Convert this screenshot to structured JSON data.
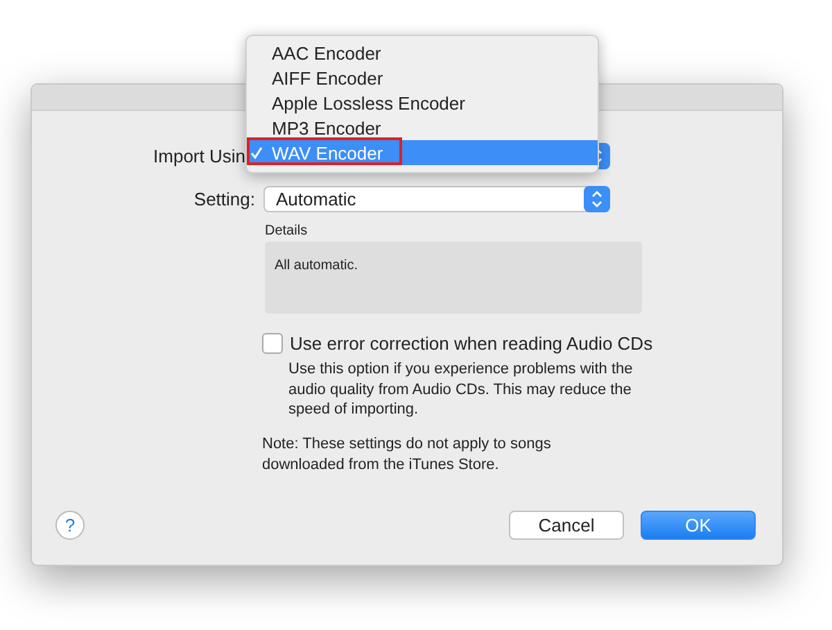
{
  "menu": {
    "items": [
      {
        "label": "AAC Encoder",
        "selected": false,
        "annotated": false
      },
      {
        "label": "AIFF Encoder",
        "selected": false,
        "annotated": false
      },
      {
        "label": "Apple Lossless Encoder",
        "selected": false,
        "annotated": false
      },
      {
        "label": "MP3 Encoder",
        "selected": false,
        "annotated": false
      },
      {
        "label": "WAV Encoder",
        "selected": true,
        "annotated": true
      }
    ]
  },
  "form": {
    "import_label": "Import Usin",
    "setting_label": "Setting:",
    "setting_value": "Automatic",
    "details_label": "Details",
    "details_text": "All automatic.",
    "error_correction": {
      "label": "Use error correction when reading Audio CDs",
      "checked": false,
      "help": "Use this option if you experience problems with the audio quality from Audio CDs.  This may reduce the speed of importing."
    },
    "note": "Note: These settings do not apply to songs downloaded from the iTunes Store."
  },
  "buttons": {
    "help": "?",
    "cancel": "Cancel",
    "ok": "OK"
  }
}
